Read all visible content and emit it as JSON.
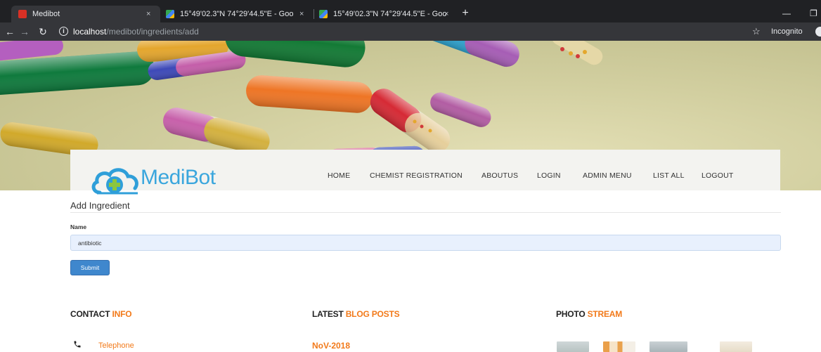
{
  "browser": {
    "tabs": [
      {
        "title": "Medibot",
        "close": "×"
      },
      {
        "title": "15°49'02.3\"N 74°29'44.5\"E - Goo",
        "close": "×"
      },
      {
        "title": "15°49'02.3\"N 74°29'44.5\"E - Goo",
        "close": "×"
      }
    ],
    "new_tab": "+",
    "url_host": "localhost",
    "url_path": "/medibot/ingredients/add",
    "incognito_label": "Incognito"
  },
  "site": {
    "logo_text": "MediBot",
    "nav": [
      "HOME",
      "CHEMIST REGISTRATION",
      "ABOUTUS",
      "LOGIN",
      "ADMIN MENU",
      "LIST ALL",
      "LOGOUT"
    ]
  },
  "form": {
    "title": "Add Ingredient",
    "name_label": "Name",
    "name_value": "antibiotic",
    "submit_label": "Submit"
  },
  "footer": {
    "contact": {
      "prefix": "CONTACT ",
      "highlight": "INFO"
    },
    "blog": {
      "prefix": "LATEST ",
      "highlight": "BLOG POSTS"
    },
    "photo": {
      "prefix": "PHOTO ",
      "highlight": "STREAM"
    },
    "telephone_label": "Telephone",
    "blog_date": "NoV-2018"
  },
  "colors": {
    "accent": "#f27a1a",
    "primary_button": "#3f87cd",
    "logo": "#3aa6dd"
  }
}
